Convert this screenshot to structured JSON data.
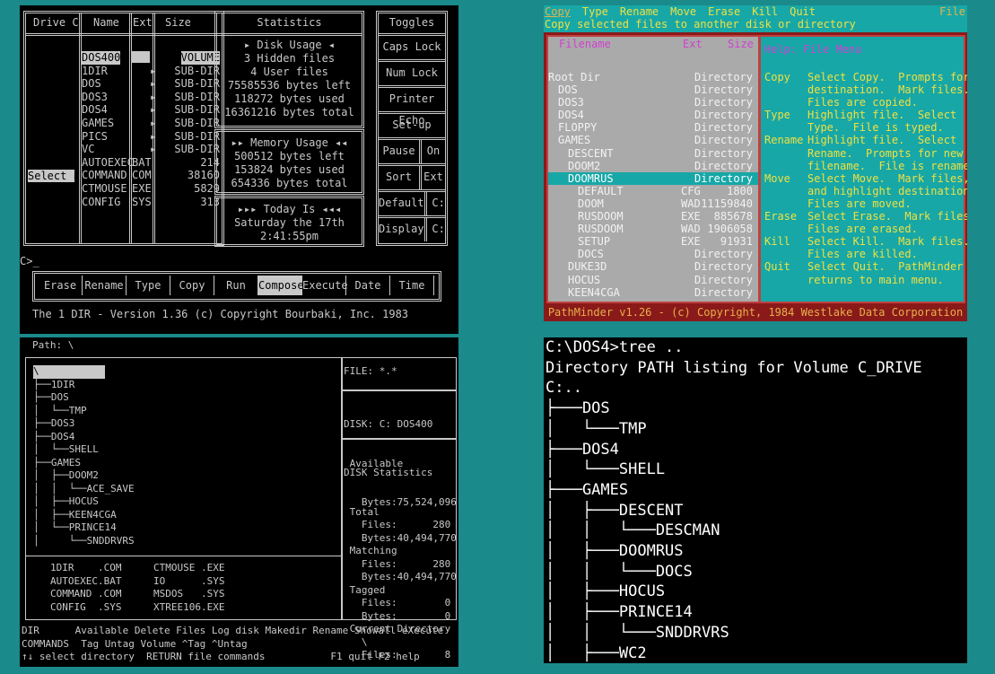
{
  "p1": {
    "headers": [
      "Drive C",
      "Name",
      "Ext",
      "Size",
      "Statistics",
      "Toggles"
    ],
    "select_label": "Select",
    "files": [
      {
        "name": "DOS400",
        "ext": "",
        "size": "VOLUME"
      },
      {
        "name": "1DIR",
        "ext": "",
        "size": "SUB-DIR"
      },
      {
        "name": "DOS",
        "ext": "",
        "size": "SUB-DIR"
      },
      {
        "name": "DOS3",
        "ext": "",
        "size": "SUB-DIR"
      },
      {
        "name": "DOS4",
        "ext": "",
        "size": "SUB-DIR"
      },
      {
        "name": "GAMES",
        "ext": "",
        "size": "SUB-DIR"
      },
      {
        "name": "PICS",
        "ext": "",
        "size": "SUB-DIR"
      },
      {
        "name": "VC",
        "ext": "",
        "size": "SUB-DIR"
      },
      {
        "name": "AUTOEXEC",
        "ext": "BAT",
        "size": "214"
      },
      {
        "name": "COMMAND",
        "ext": "COM",
        "size": "38160"
      },
      {
        "name": "CTMOUSE",
        "ext": "EXE",
        "size": "5829"
      },
      {
        "name": "CONFIG",
        "ext": "SYS",
        "size": "313"
      }
    ],
    "disk_title": "Disk Usage",
    "disk_lines": [
      "3 Hidden files",
      "4 User files",
      "75585536 bytes left",
      "118272 bytes used",
      "16361216 bytes total"
    ],
    "mem_title": "Memory Usage",
    "mem_lines": [
      "500512 bytes left",
      "153824 bytes used",
      "654336 bytes total"
    ],
    "today_title": "Today Is",
    "today_lines": [
      "Saturday the 17th",
      "2:41:55pm"
    ],
    "toggles": [
      [
        "Caps Lock"
      ],
      [
        "Num Lock"
      ],
      [
        "Printer Echo"
      ],
      [
        "Set-up"
      ],
      [
        "Pause",
        "On"
      ],
      [
        "Sort",
        "Ext"
      ],
      [
        "Default",
        "C:"
      ],
      [
        "Display",
        "C:"
      ]
    ],
    "prompt": "C>_",
    "commands": [
      "Erase",
      "Rename",
      "Type",
      "Copy",
      "Run",
      "Compose",
      "Execute",
      "Date",
      "Time"
    ],
    "footer": "The 1 DIR - Version 1.36 (c) Copyright Bourbaki, Inc. 1983"
  },
  "p2": {
    "menu": [
      "Copy",
      "Type",
      "Rename",
      "Move",
      "Erase",
      "Kill",
      "Quit"
    ],
    "menu_right": "File",
    "status": "Copy selected files to another disk or directory",
    "col_filename": "Filename",
    "col_ext": "Ext",
    "col_size": "Size",
    "rows": [
      {
        "name": "Root Dir",
        "ext": "",
        "size": "Directory",
        "indent": 0
      },
      {
        "name": "DOS",
        "ext": "",
        "size": "Directory",
        "indent": 1
      },
      {
        "name": "DOS3",
        "ext": "",
        "size": "Directory",
        "indent": 1
      },
      {
        "name": "DOS4",
        "ext": "",
        "size": "Directory",
        "indent": 1
      },
      {
        "name": "FLOPPY",
        "ext": "",
        "size": "Directory",
        "indent": 1
      },
      {
        "name": "GAMES",
        "ext": "",
        "size": "Directory",
        "indent": 1
      },
      {
        "name": "DESCENT",
        "ext": "",
        "size": "Directory",
        "indent": 2
      },
      {
        "name": "DOOM2",
        "ext": "",
        "size": "Directory",
        "indent": 2
      },
      {
        "name": "DOOMRUS",
        "ext": "",
        "size": "Directory",
        "indent": 2,
        "selected": true
      },
      {
        "name": "DEFAULT",
        "ext": "CFG",
        "size": "1800",
        "indent": 3
      },
      {
        "name": "DOOM",
        "ext": "WAD",
        "size": "11159840",
        "indent": 3
      },
      {
        "name": "RUSDOOM",
        "ext": "EXE",
        "size": "885678",
        "indent": 3
      },
      {
        "name": "RUSDOOM",
        "ext": "WAD",
        "size": "1906058",
        "indent": 3
      },
      {
        "name": "SETUP",
        "ext": "EXE",
        "size": "91931",
        "indent": 3
      },
      {
        "name": "DOCS",
        "ext": "",
        "size": "Directory",
        "indent": 3
      },
      {
        "name": "DUKE3D",
        "ext": "",
        "size": "Directory",
        "indent": 2
      },
      {
        "name": "HOCUS",
        "ext": "",
        "size": "Directory",
        "indent": 2
      },
      {
        "name": "KEEN4CGA",
        "ext": "",
        "size": "Directory",
        "indent": 2
      }
    ],
    "help_title": "Help: File Menu",
    "help": [
      {
        "key": "Copy",
        "text": [
          "Select Copy.  Prompts for",
          "destination.  Mark files.",
          "Files are copied."
        ]
      },
      {
        "key": "Type",
        "text": [
          "Highlight file.  Select",
          "Type.  File is typed."
        ]
      },
      {
        "key": "Rename",
        "text": [
          "Highlight file.  Select",
          "Rename.  Prompts for new",
          "filename.  File is renamed"
        ]
      },
      {
        "key": "Move",
        "text": [
          "Select Move.  Mark files,",
          "and highlight destination.",
          "Files are moved."
        ]
      },
      {
        "key": "Erase",
        "text": [
          "Select Erase.  Mark files.",
          "Files are erased."
        ]
      },
      {
        "key": "Kill",
        "text": [
          "Select Kill.  Mark files.",
          "Files are killed."
        ]
      },
      {
        "key": "Quit",
        "text": [
          "Select Quit.  PathMinder",
          "returns to main menu."
        ]
      }
    ],
    "footer": "PathMinder v1.26 - (c) Copyright, 1984 Westlake Data Corporation"
  },
  "p3": {
    "path": "Path: \\",
    "tree": [
      {
        "t": "\\",
        "sel": true
      },
      {
        "t": "├──1DIR"
      },
      {
        "t": "├──DOS"
      },
      {
        "t": "│  └──TMP"
      },
      {
        "t": "├──DOS3"
      },
      {
        "t": "├──DOS4"
      },
      {
        "t": "│  └──SHELL"
      },
      {
        "t": "├──GAMES"
      },
      {
        "t": "│  ├──DOOM2"
      },
      {
        "t": "│  │  └──ACE_SAVE"
      },
      {
        "t": "│  ├──HOCUS"
      },
      {
        "t": "│  ├──KEEN4CGA"
      },
      {
        "t": "│  └──PRINCE14"
      },
      {
        "t": "│     └──SNDDRVRS"
      }
    ],
    "files_left": [
      "1DIR    .COM",
      "AUTOEXEC.BAT",
      "COMMAND .COM",
      "CONFIG  .SYS"
    ],
    "files_right": [
      "CTMOUSE .EXE",
      "IO      .SYS",
      "MSDOS   .SYS",
      "XTREE106.EXE"
    ],
    "filespec": "FILE: *.*",
    "disk_lines": [
      "DISK: C: DOS400",
      " Available",
      "   Bytes:75,524,096"
    ],
    "stats_title": "DISK Statistics",
    "stats": [
      " Total",
      "   Files:      280",
      "   Bytes:40,494,770",
      " Matching",
      "   Files:      280",
      "   Bytes:40,494,770",
      " Tagged",
      "   Files:        0",
      "   Bytes:        0",
      " Current Directory",
      "   \\",
      "   Files:        8"
    ],
    "help_lines": [
      "DIR      Available Delete Files Log disk Makedir Rename Showall eXecute",
      "COMMANDS  Tag Untag Volume ^Tag ^Untag",
      "↑↓ select directory  RETURN file commands           F1 quit F2 help"
    ]
  },
  "p4": {
    "lines": [
      "C:\\DOS4>tree ..",
      "Directory PATH listing for Volume C_DRIVE",
      "C:..",
      "├───DOS",
      "│   └───TMP",
      "├───DOS4",
      "│   └───SHELL",
      "├───GAMES",
      "│   ├───DESCENT",
      "│   │   └───DESCMAN",
      "│   ├───DOOMRUS",
      "│   │   └───DOCS",
      "│   ├───HOCUS",
      "│   ├───PRINCE14",
      "│   │   └───SNDDRVRS",
      "│   ├───WC2"
    ]
  }
}
